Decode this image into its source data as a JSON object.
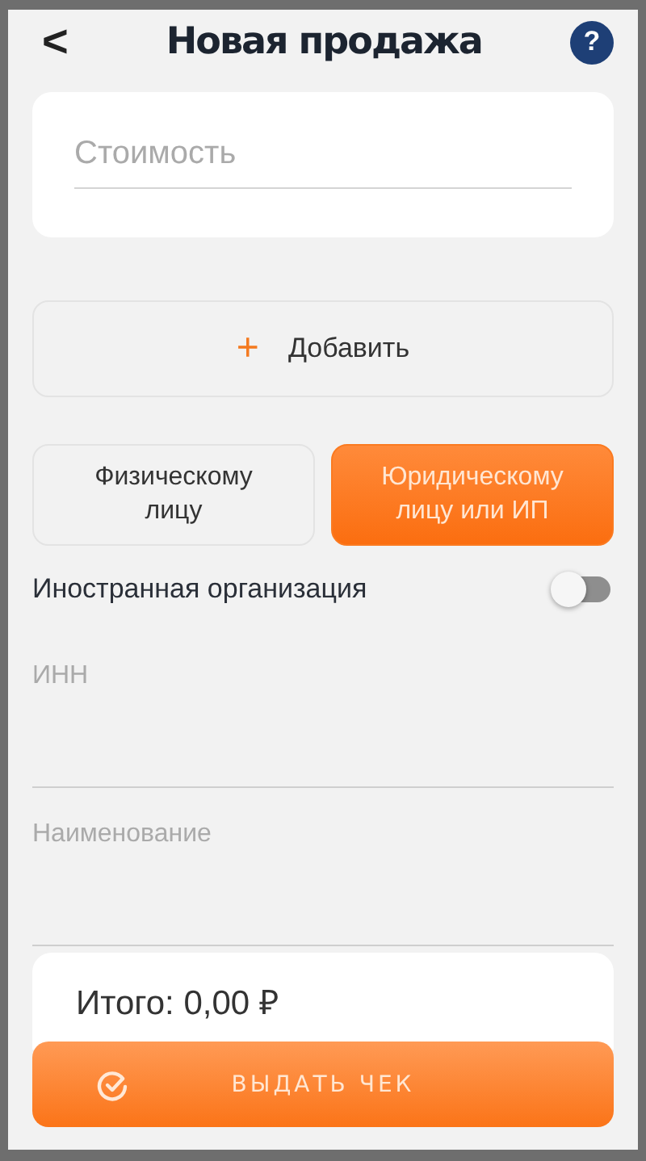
{
  "header": {
    "title": "Новая продажа",
    "back": "<",
    "help": "?"
  },
  "price_field": {
    "placeholder": "Стоимость"
  },
  "add_button": {
    "icon": "+",
    "label": "Добавить"
  },
  "buyer_types": [
    {
      "label": "Физическому лицу",
      "selected": false
    },
    {
      "label": "Юридическому лицу или ИП",
      "selected": true
    }
  ],
  "foreign_org": {
    "label": "Иностранная организация",
    "on": false
  },
  "fields": [
    {
      "placeholder": "ИНН"
    },
    {
      "placeholder": "Наименование"
    }
  ],
  "total": "Итого: 0,00 ₽",
  "submit_button": {
    "label": "ВЫДАТЬ ЧЕК"
  }
}
